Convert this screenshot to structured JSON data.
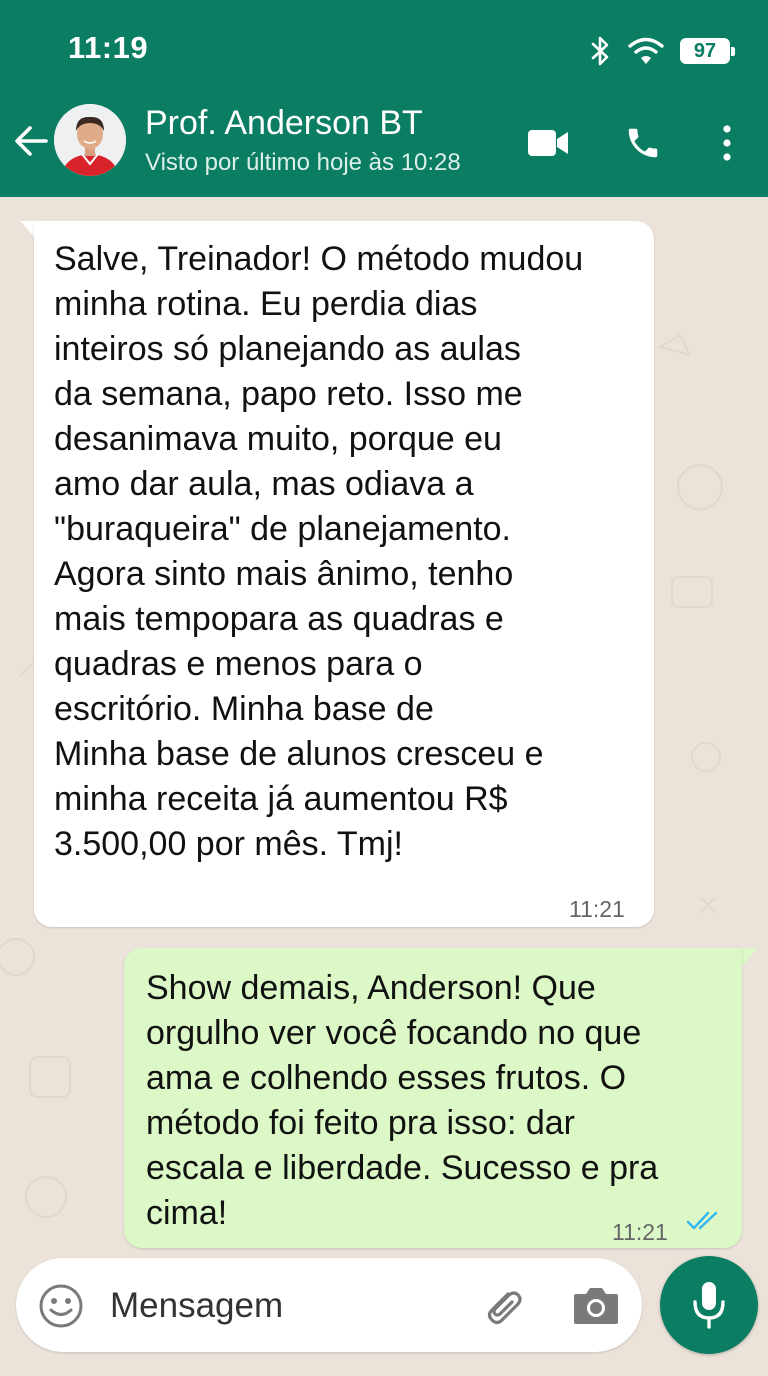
{
  "status_bar": {
    "time": "11:19",
    "battery": "97"
  },
  "header": {
    "contact_name": "Prof. Anderson BT",
    "last_seen": "Visto por último hoje às 10:28"
  },
  "messages": [
    {
      "direction": "incoming",
      "lines": [
        "Salve, Treinador! O método mudou",
        "minha rotina. Eu perdia dias",
        "inteiros só planejando as aulas",
        "da semana, papo reto. Isso me",
        "desanimava muito, porque eu",
        "amo dar aula, mas odiava a",
        "\"buraqueira\" de planejamento.",
        "Agora sinto mais ânimo, tenho",
        "mais tempopara as quadras e",
        "quadras e menos para o",
        "escritório.  Minha base de",
        "Minha base de alunos cresceu e",
        "minha receita já aumentou R$",
        "3.500,00 por mês. Tmj!"
      ],
      "time": "11:21"
    },
    {
      "direction": "outgoing",
      "lines": [
        "Show demais, Anderson! Que",
        "orgulho ver você focando no que",
        "ama e colhendo esses frutos. O",
        "método foi feito pra isso: dar",
        "escala e liberdade. Sucesso e pra",
        "cima!"
      ],
      "time": "11:21",
      "status": "read"
    }
  ],
  "composer": {
    "placeholder": "Mensagem"
  },
  "colors": {
    "header": "#0a7d62",
    "outgoing_bubble": "#dcf8c6",
    "incoming_bubble": "#ffffff",
    "chat_background": "#ebe3d9",
    "read_ticks": "#34b7f1"
  },
  "icons": [
    "bluetooth-icon",
    "wifi-icon",
    "battery-icon",
    "back-arrow-icon",
    "video-call-icon",
    "phone-icon",
    "more-options-icon",
    "emoji-icon",
    "attach-icon",
    "camera-icon",
    "mic-icon",
    "read-ticks-icon"
  ]
}
